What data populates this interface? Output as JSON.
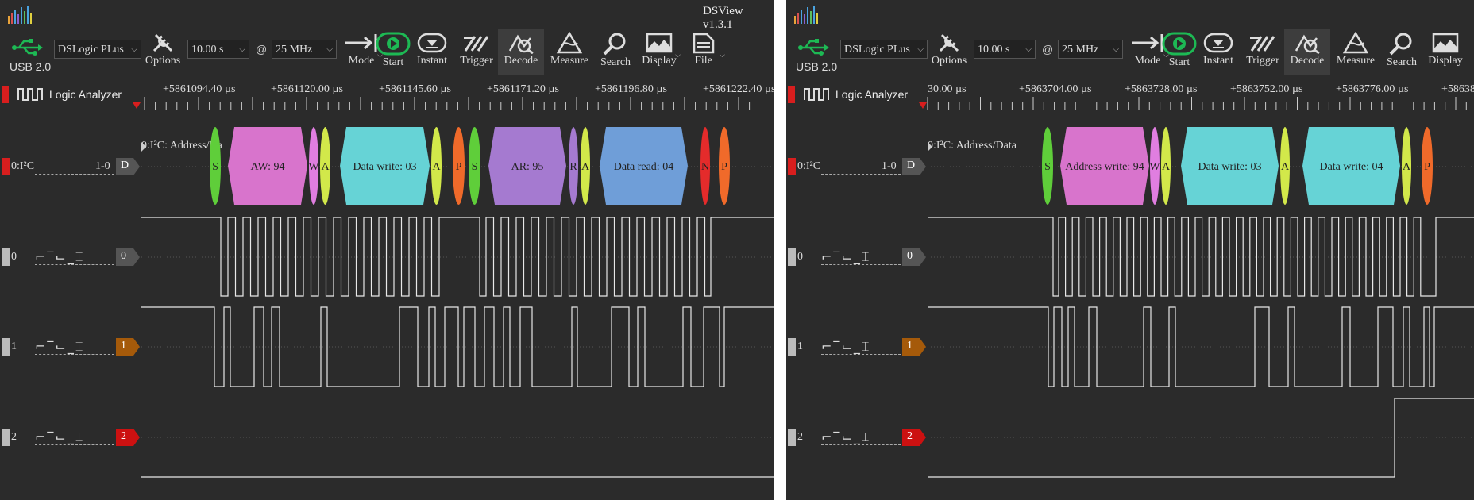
{
  "app": {
    "title": "DSView v1.3.1"
  },
  "toolbar": {
    "usb_label": "USB 2.0",
    "device": "DSLogic PLus",
    "options_label": "Options",
    "duration": "10.00 s",
    "at": "@",
    "samplerate": "25 MHz",
    "mode_label": "Mode",
    "start_label": "Start",
    "instant_label": "Instant",
    "trigger_label": "Trigger",
    "decode_label": "Decode",
    "measure_label": "Measure",
    "search_label": "Search",
    "display_label": "Display",
    "file_label": "File"
  },
  "icons": [
    "usb-icon",
    "options-icon",
    "mode-icon",
    "start-icon",
    "instant-icon",
    "trigger-icon",
    "decode-icon",
    "measure-icon",
    "search-icon",
    "display-icon",
    "file-icon",
    "logic-analyzer-icon"
  ],
  "colors": {
    "start": "#1db954",
    "red_tab": "#d81e1e",
    "ch0_badge": "#555555",
    "ch1_badge": "#a55a0a",
    "ch2_badge": "#cc1111",
    "background": "#2b2b2b"
  },
  "left": {
    "logic_analyzer_label": "Logic Analyzer",
    "ruler_ticks": [
      "+5861094.40 µs",
      "+5861120.00 µs",
      "+5861145.60 µs",
      "+5861171.20 µs",
      "+5861196.80 µs",
      "+5861222.40 µs"
    ],
    "decoder_row_title": "0:I²C: Address/Da",
    "annotations": [
      "S",
      "AW: 94",
      "W",
      "A",
      "Data write: 03",
      "A",
      "P",
      "S",
      "AR: 95",
      "R",
      "A",
      "Data read: 04",
      "N",
      "P"
    ]
  },
  "right": {
    "logic_analyzer_label": "Logic Analyzer",
    "ruler_ticks": [
      "30.00 µs",
      "+5863704.00 µs",
      "+5863728.00 µs",
      "+5863752.00 µs",
      "+5863776.00 µs",
      "+58638"
    ],
    "decoder_row_title": "0:I²C: Address/Data",
    "annotations": [
      "S",
      "Address write: 94",
      "W",
      "A",
      "Data write: 03",
      "A",
      "Data write: 04",
      "A",
      "P"
    ]
  },
  "channels": {
    "decoder": {
      "name": "0:I²C",
      "range": "1-0",
      "badge": "D"
    },
    "ch0": {
      "num": "0",
      "badge": "0"
    },
    "ch1": {
      "num": "1",
      "badge": "1"
    },
    "ch2": {
      "num": "2",
      "badge": "2"
    },
    "trigger_glyphs": "⌐‾⌙_⌶"
  }
}
